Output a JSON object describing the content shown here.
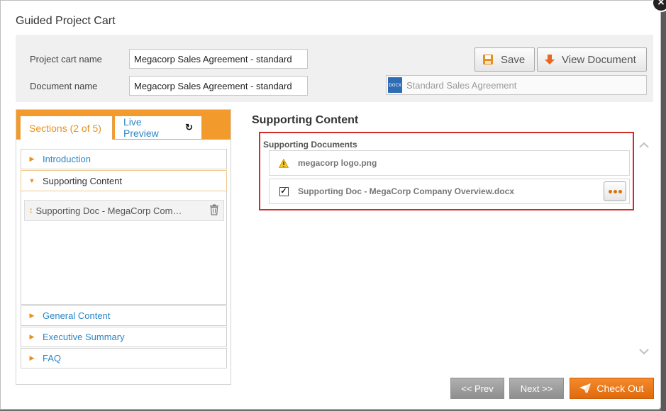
{
  "dialog": {
    "title": "Guided Project Cart",
    "close_glyph": "×"
  },
  "header": {
    "project_cart_label": "Project cart name",
    "project_cart_value": "Megacorp Sales Agreement - standard",
    "document_label": "Document name",
    "document_value": "Megacorp Sales Agreement - standard",
    "save_label": "Save",
    "view_document_label": "View Document",
    "template_badge": "DOCX",
    "template_name": "Standard Sales Agreement"
  },
  "tabs": {
    "sections": "Sections (2 of 5)",
    "live_preview": "Live Preview",
    "refresh_glyph": "↻"
  },
  "sections": [
    {
      "label": "Introduction",
      "state": "collapsed"
    },
    {
      "label": "Supporting Content",
      "state": "expanded"
    },
    {
      "label": "General Content",
      "state": "collapsed"
    },
    {
      "label": "Executive Summary",
      "state": "collapsed"
    },
    {
      "label": "FAQ",
      "state": "collapsed"
    }
  ],
  "section_items": [
    {
      "label": "Supporting Doc - MegaCorp Com…"
    }
  ],
  "content": {
    "title": "Supporting Content",
    "group_heading": "Supporting Documents",
    "documents": [
      {
        "label": "megacorp logo.png",
        "status": "warning"
      },
      {
        "label": "Supporting Doc - MegaCorp Company Overview.docx",
        "status": "checked",
        "check_glyph": "✓"
      }
    ]
  },
  "footer": {
    "prev_label": "<< Prev",
    "next_label": "Next >>",
    "checkout_label": "Check Out"
  },
  "colors": {
    "accent": "#f29b2c",
    "link": "#2a86c4",
    "highlight_border": "#d52a2a",
    "checkout": "#e8781a"
  }
}
